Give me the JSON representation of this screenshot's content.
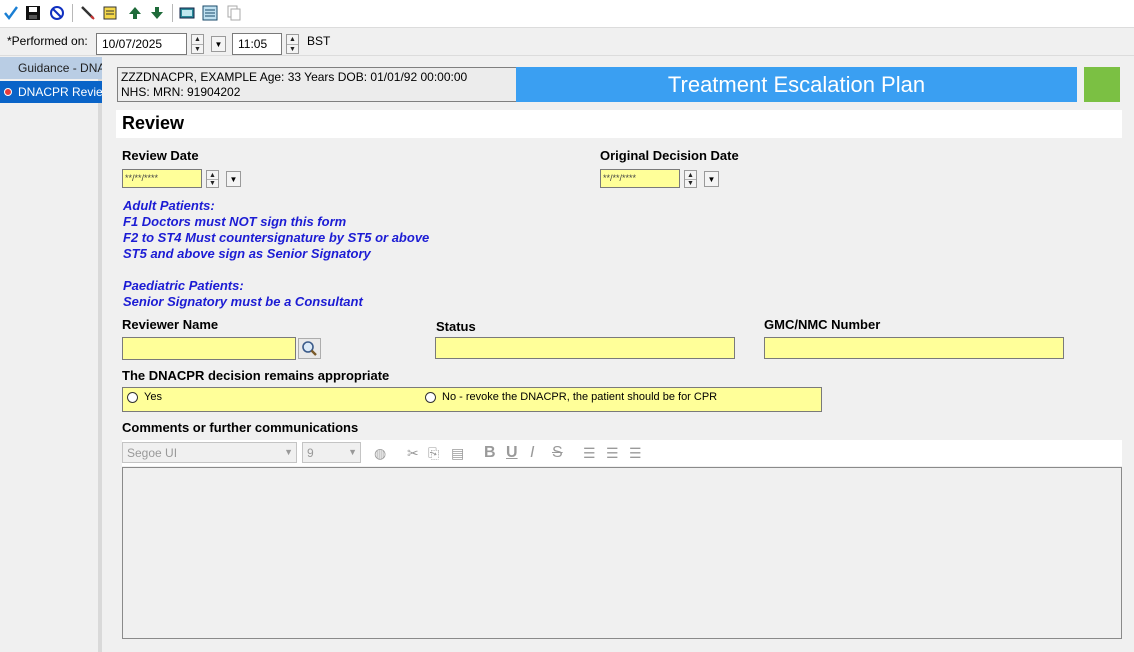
{
  "toolbar": {
    "icons": [
      "sign-checkmark-icon",
      "save-icon",
      "cancel-icon",
      "pen-icon",
      "document-icon",
      "up-arrow-icon",
      "down-arrow-icon",
      "keyboard-icon",
      "form-browser-icon",
      "copy-form-icon"
    ]
  },
  "performed": {
    "label": "*Performed on:",
    "date": "10/07/2025",
    "time": "11:05",
    "timezone": "BST"
  },
  "nav": {
    "items": [
      {
        "label": "Guidance - DNACPR",
        "state": "normal"
      },
      {
        "label": "DNACPR Review",
        "state": "selected"
      }
    ]
  },
  "patient": {
    "line1": "ZZZDNACPR, EXAMPLE Age: 33 Years DOB:  01/01/92 00:00:00",
    "line2": "NHS:  MRN: 91904202"
  },
  "form": {
    "title": "Treatment Escalation Plan",
    "section": "Review",
    "review_date_label": "Review Date",
    "review_date_value": "**/**/****",
    "original_date_label": "Original Decision Date",
    "original_date_value": "**/**/****",
    "guidance_adult": [
      "Adult Patients:",
      "F1 Doctors must NOT sign this form",
      "F2 to ST4 Must countersignature by ST5 or above",
      "ST5 and above sign as Senior Signatory"
    ],
    "guidance_paed": [
      "Paediatric Patients:",
      "Senior Signatory must be a Consultant"
    ],
    "reviewer_name_label": "Reviewer Name",
    "reviewer_name_value": "",
    "status_label": "Status",
    "status_value": "",
    "gmc_label": "GMC/NMC Number",
    "gmc_value": "",
    "decision_label": "The DNACPR decision remains appropriate",
    "decision_options": [
      "Yes",
      "No - revoke the DNACPR, the patient should be for CPR"
    ],
    "comments_label": "Comments or further communications"
  },
  "editor": {
    "font": "Segoe UI",
    "size": "9"
  },
  "colors": {
    "title_bar": "#3a9ff2",
    "status_square": "#7bc043",
    "field_yellow": "#ffff99",
    "guidance_text": "#1c1cd4",
    "nav_selected": "#0a64c8"
  }
}
